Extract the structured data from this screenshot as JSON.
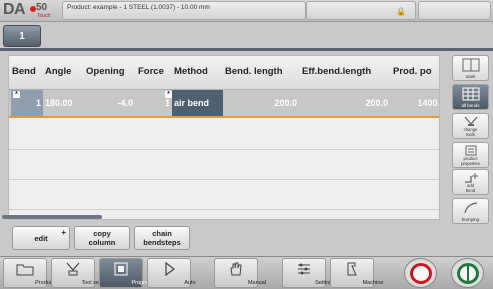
{
  "app": {
    "logo_text": "DA",
    "logo_number": "50",
    "logo_sub": "Touch"
  },
  "header": {
    "product_label": "Product: example - 1 STEEL (1.0037) - 10.00 mm"
  },
  "tab": {
    "label": "1"
  },
  "table": {
    "columns": [
      "Bend",
      "Angle",
      "Opening",
      "Force",
      "Method",
      "Bend. length",
      "Eff.bend.length",
      "Prod. po"
    ],
    "rows": [
      {
        "bend": "1",
        "angle": "180.00",
        "opening": "-4.0",
        "force": "1",
        "method": "air bend",
        "bend_length": "200.0",
        "eff_bend_length": "200.0",
        "prod_pos": "1400."
      }
    ]
  },
  "actions": {
    "edit": "edit",
    "copy_column_line1": "copy",
    "copy_column_line2": "column",
    "chain_line1": "chain",
    "chain_line2": "bendsteps"
  },
  "side": {
    "main": "main",
    "all_bends": "all bends",
    "change_tools_1": "change",
    "change_tools_2": "tools",
    "product_props_1": "product",
    "product_props_2": "properties",
    "add_bend_1": "add",
    "add_bend_2": "bend",
    "bumping": "bumping"
  },
  "nav": {
    "products": "Products",
    "tool_setup": "Tool setup",
    "program": "Program",
    "auto": "Auto",
    "manual": "Manual",
    "settings": "Settings",
    "machine": "Machine"
  }
}
